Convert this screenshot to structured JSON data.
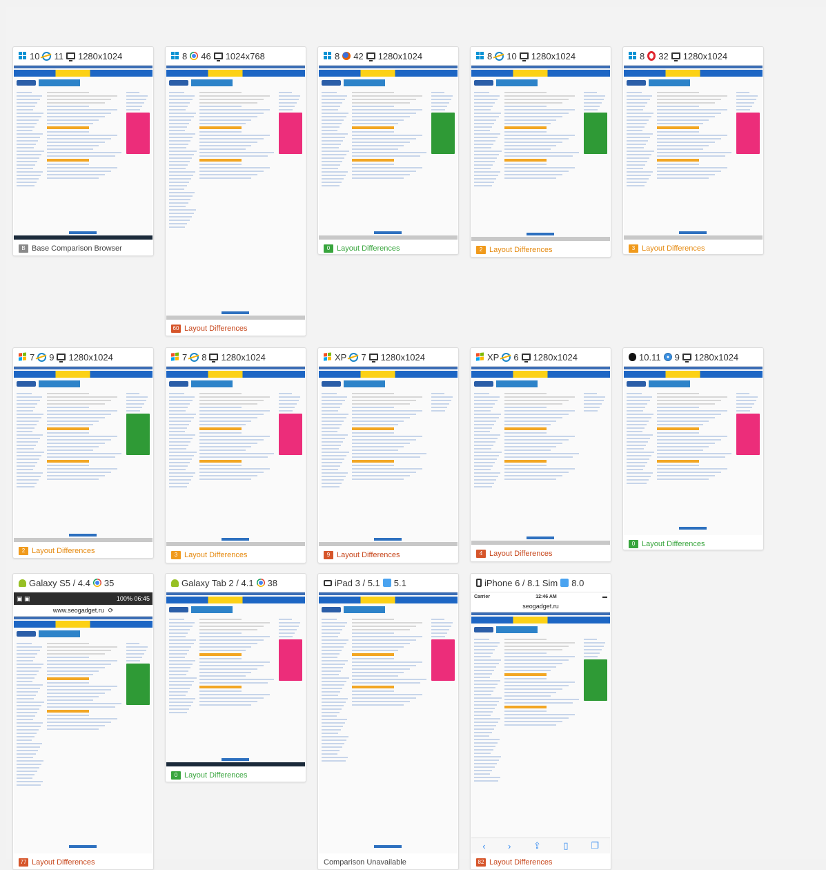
{
  "cards": [
    {
      "id": "c1",
      "os_icon": "win",
      "os": "10",
      "browser_icon": "ie",
      "browser": "11",
      "screen_icon": "monitor",
      "res": "1280x1024",
      "badge": "B",
      "badge_color": "grey",
      "status": "Base Comparison Browser",
      "status_color": "base",
      "ad": "pink",
      "taskbar": "dark"
    },
    {
      "id": "c2",
      "os_icon": "win",
      "os": "8",
      "browser_icon": "chrome",
      "browser": "46",
      "screen_icon": "monitor",
      "res": "1024x768",
      "badge": "60",
      "badge_color": "red",
      "status": "Layout Differences",
      "status_color": "red",
      "ad": "pink",
      "taskbar": "grey"
    },
    {
      "id": "c3",
      "os_icon": "win",
      "os": "8",
      "browser_icon": "firefox",
      "browser": "42",
      "screen_icon": "monitor",
      "res": "1280x1024",
      "badge": "0",
      "badge_color": "green",
      "status": "Layout Differences",
      "status_color": "green",
      "ad": "green",
      "taskbar": "grey"
    },
    {
      "id": "c4",
      "os_icon": "win",
      "os": "8",
      "browser_icon": "ie",
      "browser": "10",
      "screen_icon": "monitor",
      "res": "1280x1024",
      "badge": "2",
      "badge_color": "orange",
      "status": "Layout Differences",
      "status_color": "orange",
      "ad": "green",
      "taskbar": "grey"
    },
    {
      "id": "c5",
      "os_icon": "win",
      "os": "8",
      "browser_icon": "opera",
      "browser": "32",
      "screen_icon": "monitor",
      "res": "1280x1024",
      "badge": "3",
      "badge_color": "orange",
      "status": "Layout Differences",
      "status_color": "orange",
      "ad": "pink",
      "taskbar": "grey"
    },
    {
      "id": "c6",
      "os_icon": "winxp",
      "os": "7",
      "browser_icon": "ie",
      "browser": "9",
      "screen_icon": "monitor",
      "res": "1280x1024",
      "badge": "2",
      "badge_color": "orange",
      "status": "Layout Differences",
      "status_color": "orange",
      "ad": "green",
      "taskbar": "grey"
    },
    {
      "id": "c7",
      "os_icon": "winxp",
      "os": "7",
      "browser_icon": "ie",
      "browser": "8",
      "screen_icon": "monitor",
      "res": "1280x1024",
      "badge": "3",
      "badge_color": "orange",
      "status": "Layout Differences",
      "status_color": "orange",
      "ad": "pink",
      "taskbar": "grey"
    },
    {
      "id": "c8",
      "os_icon": "winxp",
      "os": "XP",
      "browser_icon": "ie",
      "browser": "7",
      "screen_icon": "monitor",
      "res": "1280x1024",
      "badge": "9",
      "badge_color": "red",
      "status": "Layout Differences",
      "status_color": "red",
      "ad": "none",
      "taskbar": "grey"
    },
    {
      "id": "c9",
      "os_icon": "winxp",
      "os": "XP",
      "browser_icon": "ie",
      "browser": "6",
      "screen_icon": "monitor",
      "res": "1280x1024",
      "badge": "4",
      "badge_color": "red",
      "status": "Layout Differences",
      "status_color": "red",
      "ad": "none",
      "taskbar": "grey"
    },
    {
      "id": "c10",
      "os_icon": "apple",
      "os": "10.11",
      "browser_icon": "safari",
      "browser": "9",
      "screen_icon": "monitor",
      "res": "1280x1024",
      "badge": "0",
      "badge_color": "green",
      "status": "Layout Differences",
      "status_color": "green",
      "ad": "pink",
      "taskbar": "none"
    },
    {
      "id": "c11",
      "os_icon": "android",
      "os": "Galaxy S5 / 4.4",
      "browser_icon": "chrome",
      "browser": "35",
      "screen_icon": "",
      "res": "",
      "badge": "77",
      "badge_color": "red",
      "status": "Layout Differences",
      "status_color": "red",
      "ad": "green",
      "taskbar": "none",
      "mobile": {
        "time": "06:45",
        "battery": "100%",
        "url": "www.seogadget.ru"
      }
    },
    {
      "id": "c12",
      "os_icon": "android",
      "os": "Galaxy Tab 2 / 4.1",
      "browser_icon": "chrome",
      "browser": "38",
      "screen_icon": "",
      "res": "",
      "badge": "0",
      "badge_color": "green",
      "status": "Layout Differences",
      "status_color": "green",
      "ad": "pink",
      "taskbar": "dark"
    },
    {
      "id": "c13",
      "os_icon": "tablet",
      "os": "iPad 3 / 5.1",
      "browser_icon": "ipadsafari",
      "browser": "5.1",
      "screen_icon": "",
      "res": "",
      "badge": "",
      "badge_color": "",
      "status": "Comparison Unavailable",
      "status_color": "none",
      "ad": "pink",
      "taskbar": "none"
    },
    {
      "id": "c14",
      "os_icon": "phone",
      "os": "iPhone 6 / 8.1 Sim",
      "browser_icon": "ipadsafari",
      "browser": "8.0",
      "screen_icon": "",
      "res": "",
      "badge": "82",
      "badge_color": "red",
      "status": "Layout Differences",
      "status_color": "red",
      "ad": "green",
      "taskbar": "none",
      "ios": {
        "carrier": "Carrier",
        "time": "12:46 AM",
        "url": "seogadget.ru"
      }
    }
  ]
}
